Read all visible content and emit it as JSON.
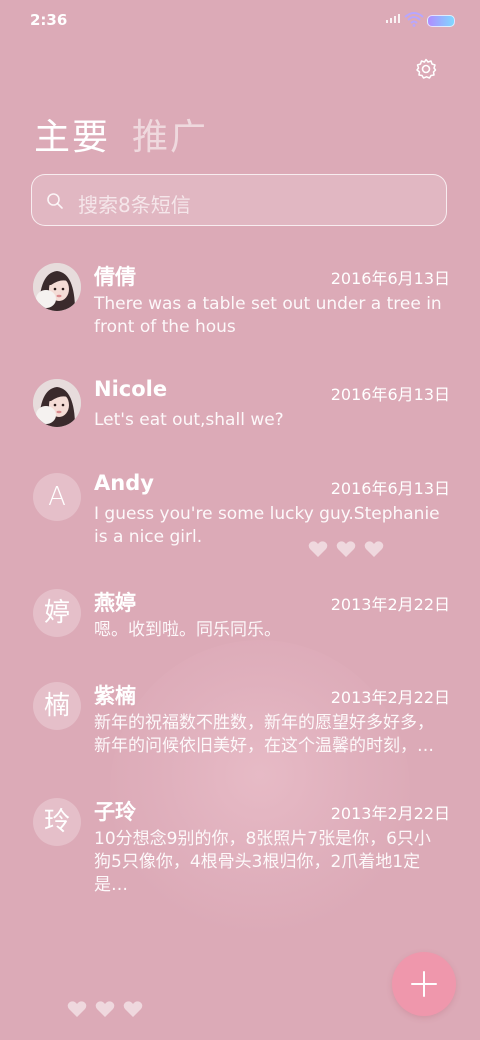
{
  "status": {
    "time": "2:36"
  },
  "header": {
    "settings_icon": "gear-icon",
    "tabs": [
      {
        "label": "主要",
        "active": true
      },
      {
        "label": "推广",
        "active": false
      }
    ]
  },
  "search": {
    "placeholder": "搜索8条短信",
    "icon": "search-icon"
  },
  "conversations": [
    {
      "name": "倩倩",
      "date": "2016年6月13日",
      "preview": "There was a table set out under a tree in front of the hous",
      "avatar": "photo"
    },
    {
      "name": "Nicole",
      "date": "2016年6月13日",
      "preview": "Let's eat out,shall we?",
      "avatar": "photo"
    },
    {
      "name": "Andy",
      "date": "2016年6月13日",
      "preview": "I guess you're some lucky guy.Stephanie is a nice girl.",
      "avatar_letter": "A"
    },
    {
      "name": "燕婷",
      "date": "2013年2月22日",
      "preview": "嗯。收到啦。同乐同乐。",
      "avatar_letter": "婷"
    },
    {
      "name": "紫楠",
      "date": "2013年2月22日",
      "preview": "新年的祝福数不胜数，新年的愿望好多好多，新年的问候依旧美好，在这个温馨的时刻，…",
      "avatar_letter": "楠"
    },
    {
      "name": "子玲",
      "date": "2013年2月22日",
      "preview": "10分想念9别的你，8张照片7张是你，6只小狗5只像你，4根骨头3根归你，2爪着地1定是…",
      "avatar_letter": "玲"
    }
  ],
  "fab": {
    "icon": "plus-icon"
  },
  "colors": {
    "background": "#dcaab7",
    "fab": "#ef97ac"
  }
}
